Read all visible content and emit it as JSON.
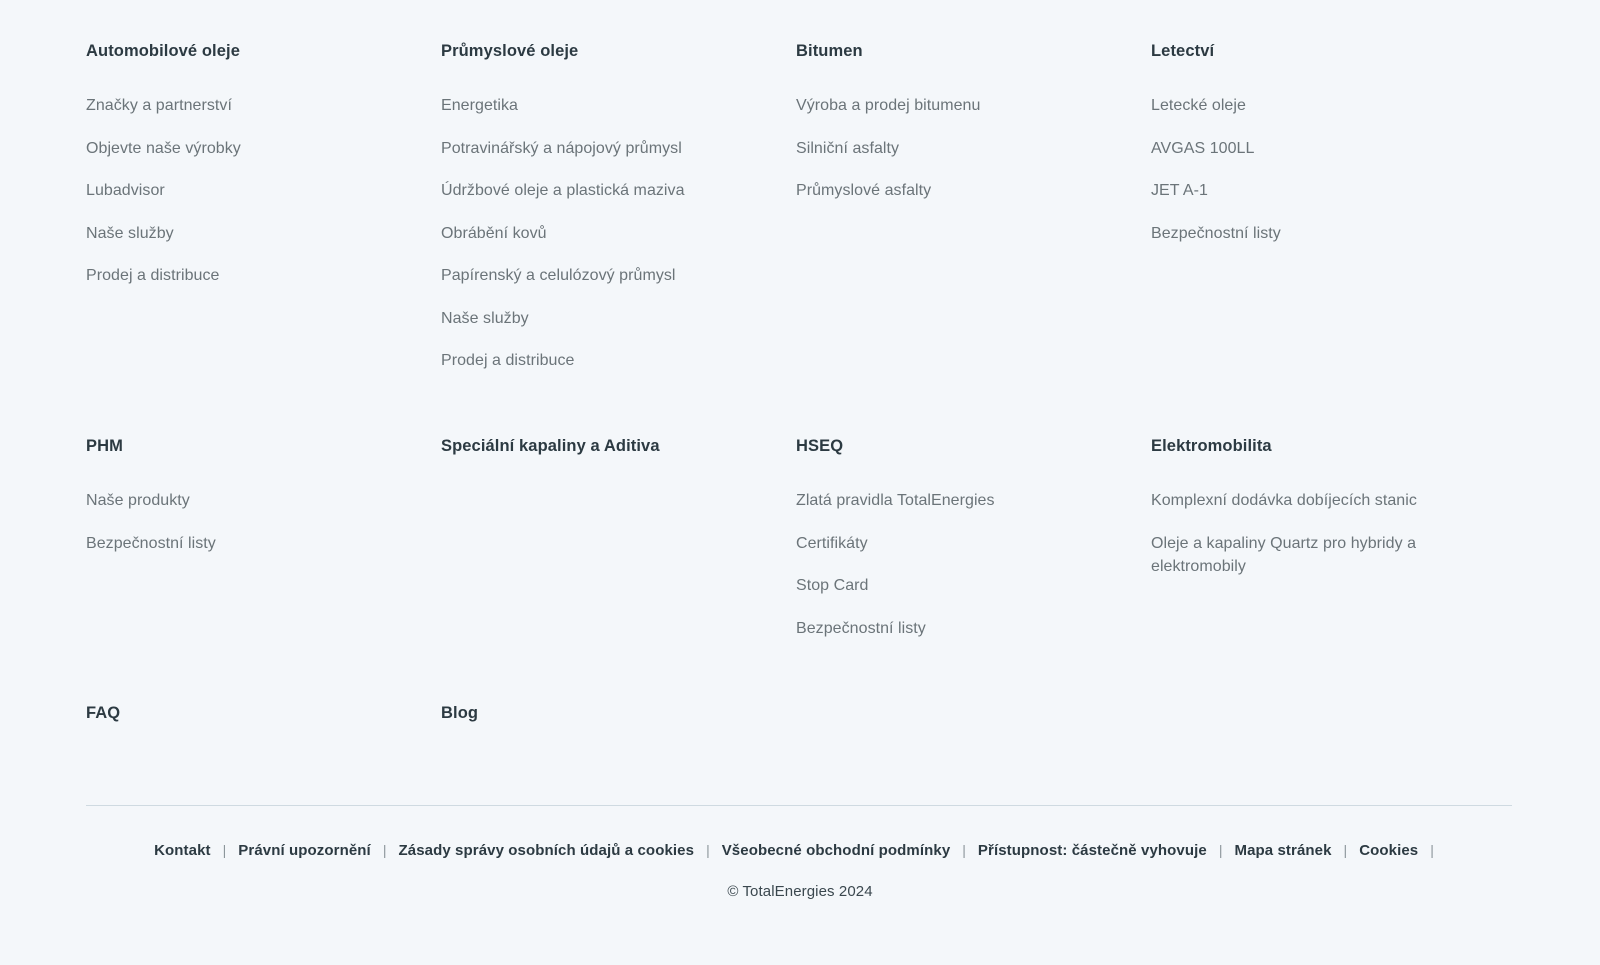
{
  "theme": {
    "background": "#f4f7fa",
    "heading_color": "#2c3a42",
    "link_color": "#6b7479",
    "divider_color": "#cfdae1",
    "separator_color": "#8c969b"
  },
  "nav_rows": [
    {
      "blocks": [
        {
          "title": "Automobilové oleje",
          "links": [
            "Značky a partnerství",
            "Objevte naše výrobky",
            "Lubadvisor",
            "Naše služby",
            "Prodej a distribuce"
          ]
        },
        {
          "title": "Průmyslové oleje",
          "links": [
            "Energetika",
            "Potravinářský a nápojový průmysl",
            "Údržbové oleje a plastická maziva",
            "Obrábění kovů",
            "Papírenský a celulózový průmysl",
            "Naše služby",
            "Prodej a distribuce"
          ]
        },
        {
          "title": "Bitumen",
          "links": [
            "Výroba a prodej bitumenu",
            "Silniční asfalty",
            "Průmyslové asfalty"
          ]
        },
        {
          "title": "Letectví",
          "links": [
            "Letecké oleje",
            "AVGAS 100LL",
            "JET A-1",
            "Bezpečnostní listy"
          ]
        }
      ]
    },
    {
      "blocks": [
        {
          "title": "PHM",
          "links": [
            "Naše produkty",
            "Bezpečnostní listy"
          ]
        },
        {
          "title": "Speciální kapaliny a Aditiva",
          "links": []
        },
        {
          "title": "HSEQ",
          "links": [
            "Zlatá pravidla TotalEnergies",
            "Certifikáty",
            "Stop Card",
            "Bezpečnostní listy"
          ]
        },
        {
          "title": "Elektromobilita",
          "links": [
            "Komplexní dodávka dobíjecích stanic",
            "Oleje a kapaliny Quartz pro hybridy a elektromobily"
          ]
        }
      ]
    },
    {
      "blocks": [
        {
          "title": "FAQ",
          "links": []
        },
        {
          "title": "Blog",
          "links": []
        }
      ]
    }
  ],
  "bottom_bar": {
    "separator": "|",
    "links": [
      "Kontakt",
      "Právní upozornění",
      "Zásady správy osobních údajů a cookies",
      "Všeobecné obchodní podmínky",
      "Přístupnost: částečně vyhovuje",
      "Mapa stránek",
      "Cookies"
    ],
    "trailing_separator": "|"
  },
  "copyright": "© TotalEnergies 2024"
}
